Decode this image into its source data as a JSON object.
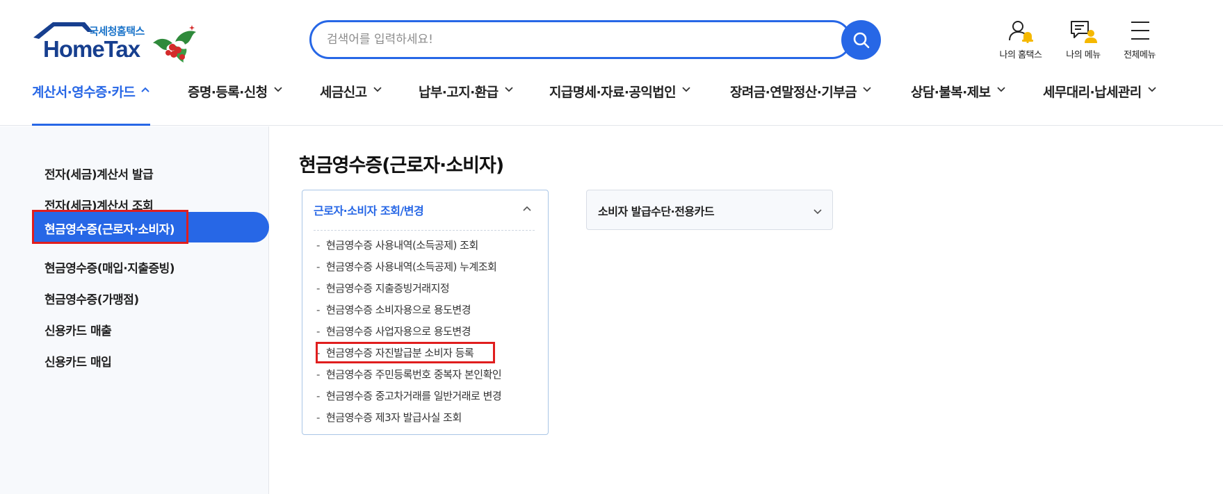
{
  "header": {
    "logo_sub": "국세청홈택스",
    "logo_main": "HomeTax",
    "search_placeholder": "검색어를 입력하세요!",
    "utils": [
      {
        "label": "나의 홈택스",
        "icon": "my-hometax-icon"
      },
      {
        "label": "나의 메뉴",
        "icon": "my-menu-icon"
      },
      {
        "label": "전체메뉴",
        "icon": "hamburger-menu-icon"
      }
    ],
    "accent_color": "#2767e6"
  },
  "gnb": {
    "items": [
      {
        "label": "계산서·영수증·카드",
        "active": true
      },
      {
        "label": "증명·등록·신청"
      },
      {
        "label": "세금신고"
      },
      {
        "label": "납부·고지·환급"
      },
      {
        "label": "지급명세·자료·공익법인"
      },
      {
        "label": "장려금·연말정산·기부금"
      },
      {
        "label": "상담·불복·제보"
      },
      {
        "label": "세무대리·납세관리"
      }
    ]
  },
  "lnb": {
    "items": [
      {
        "label": "전자(세금)계산서 발급"
      },
      {
        "label": "전자(세금)계산서 조회"
      },
      {
        "label": "현금영수증(근로자·소비자)",
        "active": true
      },
      {
        "label": "현금영수증(매입·지출증빙)"
      },
      {
        "label": "현금영수증(가맹점)"
      },
      {
        "label": "신용카드 매출"
      },
      {
        "label": "신용카드 매입"
      }
    ]
  },
  "content": {
    "title": "현금영수증(근로자·소비자)",
    "accordion1": {
      "title": "근로자·소비자 조회/변경",
      "items": [
        "현금영수증 사용내역(소득공제) 조회",
        "현금영수증 사용내역(소득공제) 누계조회",
        "현금영수증 지출증빙거래지정",
        "현금영수증 소비자용으로 용도변경",
        "현금영수증 사업자용으로 용도변경",
        "현금영수증 자진발급분 소비자 등록",
        "현금영수증 주민등록번호 중복자 본인확인",
        "현금영수증 중고차거래를 일반거래로 변경",
        "현금영수증 제3자 발급사실 조회"
      ]
    },
    "accordion2": {
      "title": "소비자 발급수단·전용카드"
    }
  }
}
